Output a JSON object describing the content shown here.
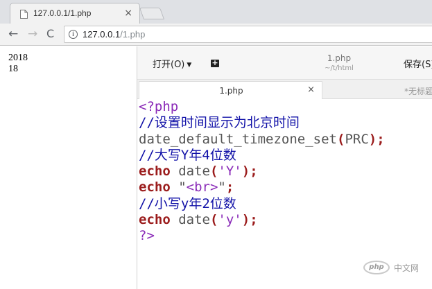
{
  "browser": {
    "tab": {
      "title": "127.0.0.1/1.php",
      "close": "×"
    },
    "nav": {
      "back": "←",
      "forward": "→",
      "reload": "C"
    },
    "address": {
      "info": "i",
      "host": "127.0.0.1",
      "path": "/1.php"
    }
  },
  "page_output": {
    "lines": [
      "2018",
      "18"
    ]
  },
  "editor": {
    "toolbar": {
      "open_label": "打开(O)",
      "open_caret": "▼",
      "file_name": "1.php",
      "file_path": "~/t/html",
      "save_label": "保存(S)"
    },
    "tabs": [
      {
        "label": "1.php",
        "close": "×"
      },
      {
        "label": "*无标题"
      }
    ],
    "code_lines": [
      [
        {
          "t": "<?php",
          "c": "tag"
        }
      ],
      [
        {
          "t": "//设置时间显示为北京时间",
          "c": "comment"
        }
      ],
      [
        {
          "t": "date_default_timezone_set",
          "c": "func"
        },
        {
          "t": "(",
          "c": "paren"
        },
        {
          "t": "PRC",
          "c": "plain"
        },
        {
          "t": ");",
          "c": "paren"
        }
      ],
      [
        {
          "t": "//大写Y年4位数",
          "c": "comment"
        }
      ],
      [
        {
          "t": "echo",
          "c": "keyword"
        },
        {
          "t": " date",
          "c": "plain"
        },
        {
          "t": "(",
          "c": "paren"
        },
        {
          "t": "'Y'",
          "c": "string"
        },
        {
          "t": ");",
          "c": "paren"
        }
      ],
      [
        {
          "t": "echo",
          "c": "keyword"
        },
        {
          "t": " \"",
          "c": "plain"
        },
        {
          "t": "<br>",
          "c": "string"
        },
        {
          "t": "\"",
          "c": "plain"
        },
        {
          "t": ";",
          "c": "paren"
        }
      ],
      [
        {
          "t": "//小写y年2位数",
          "c": "comment"
        }
      ],
      [
        {
          "t": "echo",
          "c": "keyword"
        },
        {
          "t": " date",
          "c": "plain"
        },
        {
          "t": "(",
          "c": "paren"
        },
        {
          "t": "'y'",
          "c": "string"
        },
        {
          "t": ");",
          "c": "paren"
        }
      ],
      [
        {
          "t": "?>",
          "c": "tag"
        }
      ]
    ]
  },
  "watermark": {
    "logo": "php",
    "text": "中文网"
  }
}
